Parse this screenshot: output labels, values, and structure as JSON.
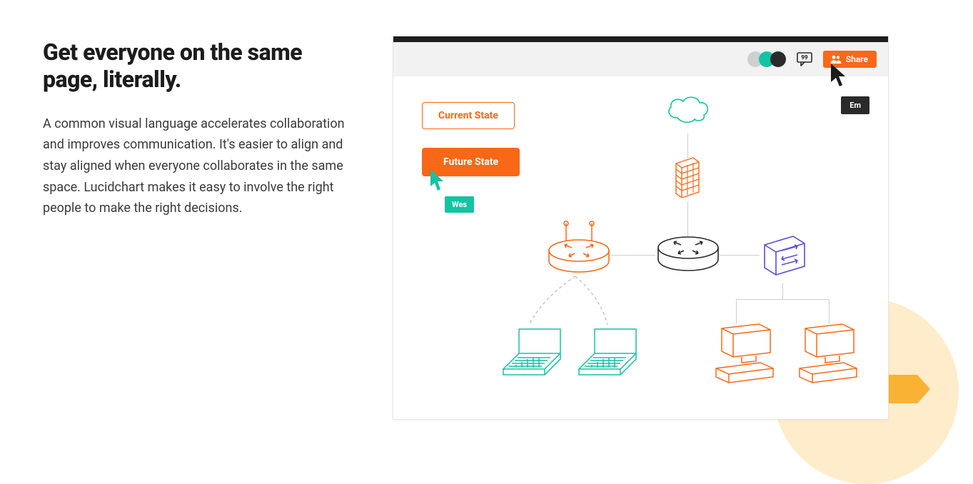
{
  "headline": "Get everyone on the same page, literally.",
  "body": "A common visual language accelerates collaboration and improves communication. It's easier to align and stay aligned when everyone collaborates in the same space. Lucidchart makes it easy to involve the right people to make the right decisions.",
  "app": {
    "toolbar": {
      "share_label": "Share"
    },
    "canvas": {
      "current_state_label": "Current State",
      "future_state_label": "Future State",
      "user_wes": "Wes",
      "user_em": "Em"
    }
  }
}
